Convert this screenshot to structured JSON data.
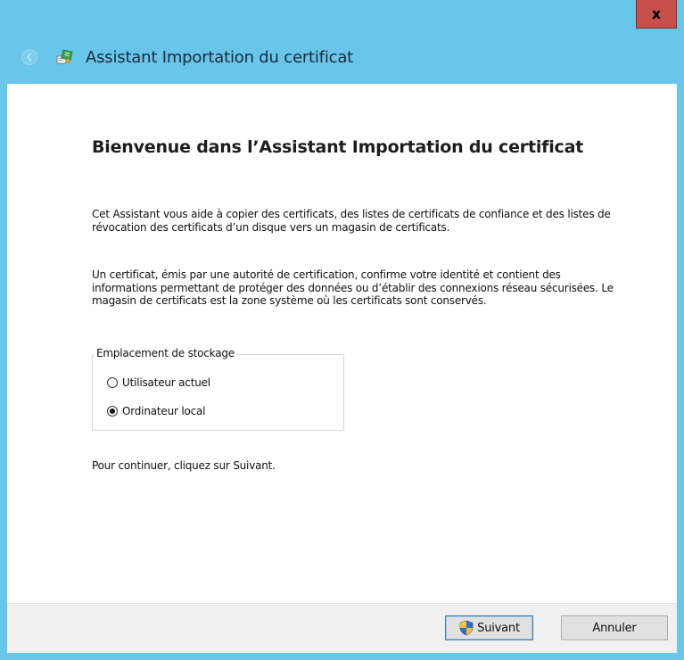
{
  "window": {
    "close_label": "x"
  },
  "header": {
    "title": "Assistant Importation du certificat",
    "back_icon": "back-arrow-icon",
    "wizard_icon": "certificate-wizard-icon"
  },
  "content": {
    "welcome_title": "Bienvenue dans l’Assistant Importation du certificat",
    "paragraph1": "Cet Assistant vous aide à copier des certificats, des listes de certificats de confiance et des listes de révocation des certificats d’un disque vers un magasin de certificats.",
    "paragraph2": "Un certificat, émis par une autorité de certification, confirme votre identité et contient des informations permettant de protéger des données ou d’établir des connexions réseau sécurisées. Le magasin de certificats est la zone système où les certificats sont conservés.",
    "storage": {
      "legend": "Emplacement de stockage",
      "options": [
        {
          "label": "Utilisateur actuel",
          "selected": false
        },
        {
          "label": "Ordinateur local",
          "selected": true
        }
      ]
    },
    "continue_text": "Pour continuer, cliquez sur Suivant."
  },
  "footer": {
    "next_label": "Suivant",
    "next_icon": "uac-shield-icon",
    "cancel_label": "Annuler"
  },
  "colors": {
    "titlebar": "#68c6ea",
    "close": "#c7504a",
    "footer": "#f0f0f0",
    "content": "#ffffff"
  }
}
